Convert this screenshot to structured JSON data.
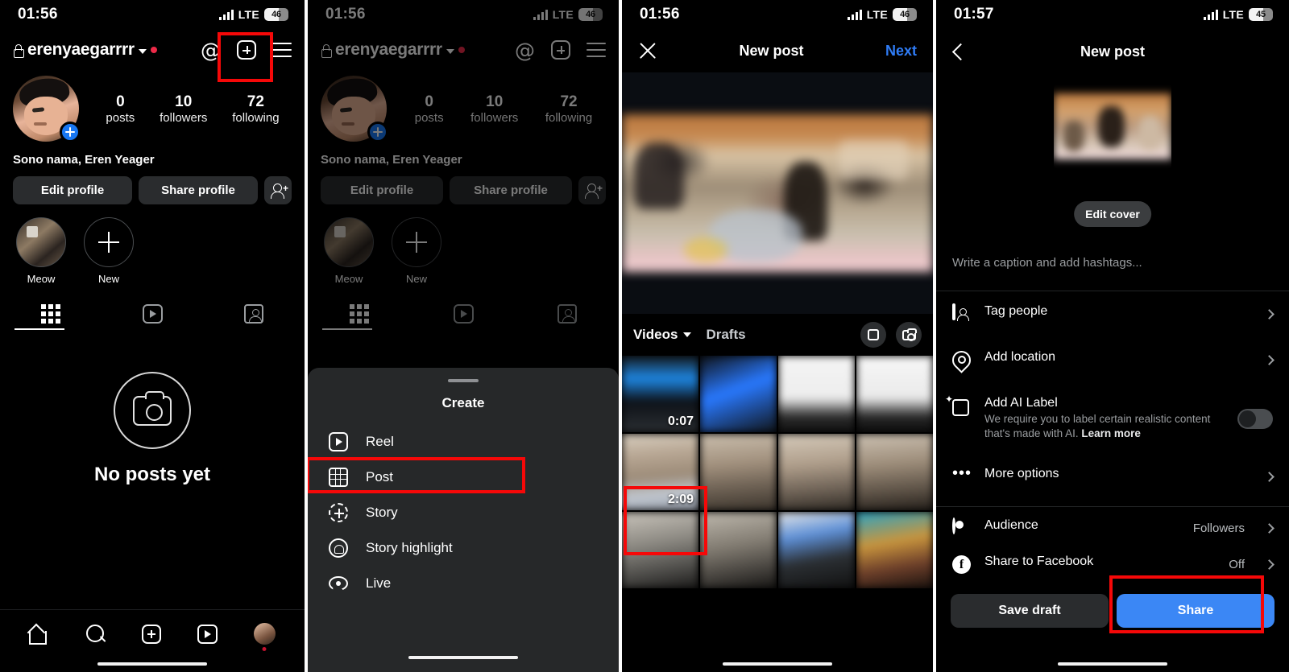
{
  "panels": [
    {
      "id": "profile",
      "status": {
        "time": "01:56",
        "network": "LTE",
        "battery": "46"
      },
      "header": {
        "username": "erenyaegarrrr",
        "lock_icon": "lock-icon",
        "threads_icon": "threads-icon",
        "create_icon": "plus-box-icon",
        "menu_icon": "hamburger-icon"
      },
      "stats": [
        {
          "number": "0",
          "label": "posts"
        },
        {
          "number": "10",
          "label": "followers"
        },
        {
          "number": "72",
          "label": "following"
        }
      ],
      "bio": "Sono nama, Eren Yeager",
      "actions": {
        "edit": "Edit profile",
        "share": "Share profile",
        "add_user_icon": "add-person-icon"
      },
      "highlights": [
        {
          "label": "Meow",
          "type": "photo"
        },
        {
          "label": "New",
          "type": "new"
        }
      ],
      "tabs": [
        {
          "name": "grid",
          "active": true
        },
        {
          "name": "reels",
          "active": false
        },
        {
          "name": "tagged",
          "active": false
        }
      ],
      "empty_state": {
        "title": "No posts yet",
        "icon": "camera-icon"
      },
      "bottom_nav": [
        "home-icon",
        "search-icon",
        "create-icon",
        "reels-icon",
        "profile-avatar"
      ]
    },
    {
      "id": "create-sheet",
      "status": {
        "time": "01:56",
        "network": "LTE",
        "battery": "46"
      },
      "sheet_title": "Create",
      "items": [
        {
          "label": "Reel",
          "icon": "reel-icon",
          "highlighted": false
        },
        {
          "label": "Post",
          "icon": "grid-post-icon",
          "highlighted": true
        },
        {
          "label": "Story",
          "icon": "story-plus-icon",
          "highlighted": false
        },
        {
          "label": "Story highlight",
          "icon": "story-highlight-icon",
          "highlighted": false
        },
        {
          "label": "Live",
          "icon": "live-broadcast-icon",
          "highlighted": false
        }
      ]
    },
    {
      "id": "media-picker",
      "status": {
        "time": "01:56",
        "network": "LTE",
        "battery": "46"
      },
      "header": {
        "close_icon": "close-icon",
        "title": "New post",
        "next": "Next"
      },
      "gallery_toolbar": {
        "album": "Videos",
        "drafts": "Drafts",
        "multiselect_icon": "multi-select-icon",
        "camera_icon": "camera-icon"
      },
      "selected_thumb_duration": "2:09",
      "grid_durations": [
        "0:07",
        "2:09"
      ]
    },
    {
      "id": "post-options",
      "status": {
        "time": "01:57",
        "network": "LTE",
        "battery": "45"
      },
      "header": {
        "back_icon": "back-chevron-icon",
        "title": "New post"
      },
      "edit_cover": "Edit cover",
      "caption_placeholder": "Write a caption and add hashtags...",
      "options": [
        {
          "label": "Tag people",
          "icon": "tag-people-icon",
          "chevron": true
        },
        {
          "label": "Add location",
          "icon": "location-pin-icon",
          "chevron": true
        },
        {
          "label": "Add AI Label",
          "icon": "ai-label-icon",
          "sub": "We require you to label certain realistic content that's made with AI. ",
          "sub_link": "Learn more",
          "toggle": "off"
        },
        {
          "label": "More options",
          "icon": "more-dots-icon",
          "chevron": true
        }
      ],
      "settings": [
        {
          "label": "Audience",
          "icon": "audience-icon",
          "value": "Followers",
          "chevron": true
        },
        {
          "label": "Share to Facebook",
          "icon": "facebook-icon",
          "value": "Off",
          "chevron": true
        }
      ],
      "buttons": {
        "save_draft": "Save draft",
        "share": "Share"
      }
    }
  ],
  "colors": {
    "highlight": "#f60808",
    "accent_blue": "#3b87f5",
    "link_blue": "#2f7cf6"
  }
}
